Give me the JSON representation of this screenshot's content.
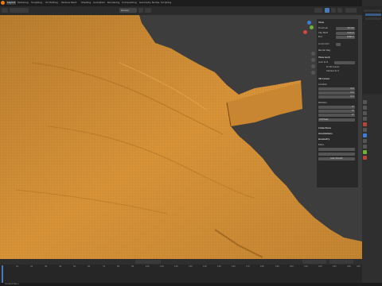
{
  "topbar": {
    "tabs": [
      "Layout",
      "Modeling",
      "Sculpting",
      "UV Editing",
      "Texture Paint",
      "Shading",
      "Animation",
      "Rendering",
      "Compositing",
      "Geometry Nodes",
      "Scripting"
    ],
    "active_index": 0
  },
  "toolbar": {
    "view_mode": "Global"
  },
  "npanel": {
    "sections": {
      "view": "View",
      "focal_length": "Focal Len",
      "focal_value": "50 mm",
      "clip_start_label": "Clip Start",
      "clip_start_value": "0.01 m",
      "clip_end_label": "End",
      "clip_end_value": "1000 m",
      "local_camera": "Local Cam",
      "render_region": "Render Reg",
      "view_lock": "View Lock",
      "lock_to_object": "Lock to O",
      "lock_to_cursor": "To 3D Cursor",
      "camera_to_view": "Camera to V",
      "cursor_3d": "3D Cursor",
      "location_label": "Location",
      "loc_x": "0 m",
      "loc_y": "0 m",
      "loc_z": "0 m",
      "rotation_label": "Rotation",
      "rot_x": "0°",
      "rot_y": "0°",
      "rot_z": "0°",
      "rotation_mode": "XYZ Euler",
      "collections": "Collections",
      "annotations": "Annotations",
      "geometry": "Geometry",
      "extra": "Extra",
      "auto_smooth": "Auto Smooth"
    }
  },
  "colors": {
    "terrain": "#e09a3c",
    "terrain_dark": "#9a5e19",
    "viewport_bg": "#3d3d3d",
    "accent_blue": "#4a7ab8"
  },
  "timeline": {
    "ticks": [
      "0",
      "10",
      "20",
      "30",
      "40",
      "50",
      "60",
      "70",
      "80",
      "90",
      "100",
      "110",
      "120",
      "130",
      "140",
      "150",
      "160",
      "170",
      "180",
      "190",
      "200",
      "210",
      "220",
      "230",
      "240",
      "250"
    ]
  },
  "statusbar": {
    "text": "Context Menu"
  }
}
